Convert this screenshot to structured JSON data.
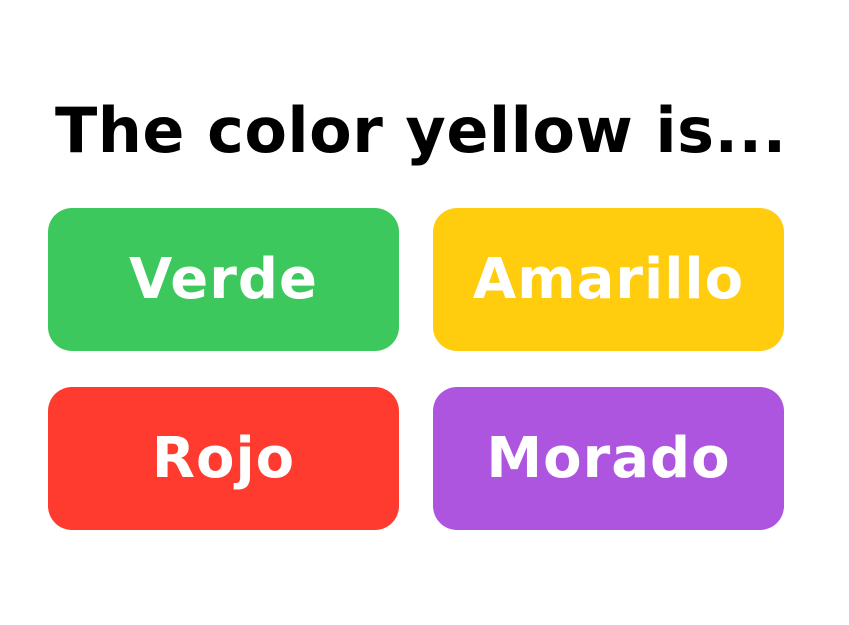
{
  "question": {
    "text": "The color yellow is..."
  },
  "answers": [
    {
      "label": "Verde",
      "color": "#3CC85C"
    },
    {
      "label": "Amarillo",
      "color": "#FFCC0E"
    },
    {
      "label": "Rojo",
      "color": "#FF3B30"
    },
    {
      "label": "Morado",
      "color": "#AD55DF"
    }
  ]
}
